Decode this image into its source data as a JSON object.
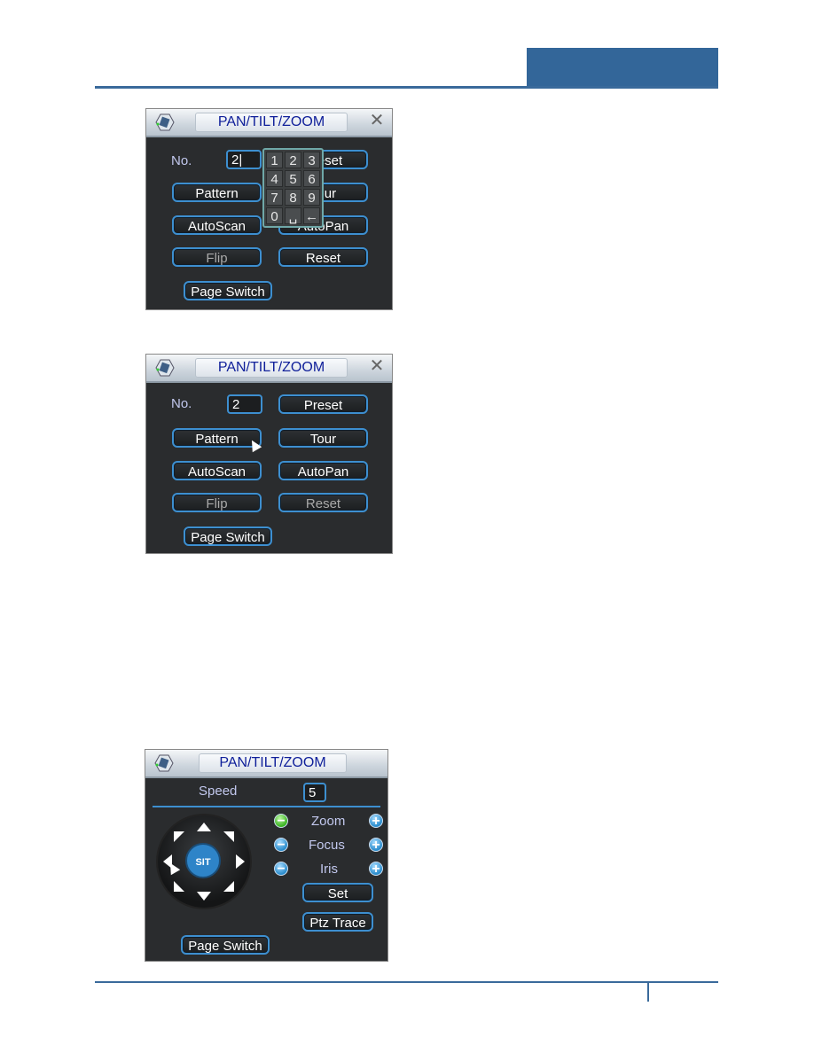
{
  "page": {
    "accent_color": "#336699"
  },
  "windows": [
    {
      "title": "PAN/TILT/ZOOM",
      "no_label": "No.",
      "no_value": "2|",
      "buttons": {
        "preset": "Preset",
        "pattern": "Pattern",
        "tour": "Tour",
        "autoscan": "AutoScan",
        "autopan": "AutoPan",
        "flip": "Flip",
        "reset": "Reset",
        "page_switch": "Page Switch"
      },
      "keypad": [
        "1",
        "2",
        "3",
        "4",
        "5",
        "6",
        "7",
        "8",
        "9",
        "0",
        "␣",
        "←"
      ]
    },
    {
      "title": "PAN/TILT/ZOOM",
      "no_label": "No.",
      "no_value": "2",
      "buttons": {
        "preset": "Preset",
        "pattern": "Pattern",
        "tour": "Tour",
        "autoscan": "AutoScan",
        "autopan": "AutoPan",
        "flip": "Flip",
        "reset": "Reset",
        "page_switch": "Page Switch"
      }
    },
    {
      "title": "PAN/TILT/ZOOM",
      "speed_label": "Speed",
      "speed_value": "5",
      "center_label": "SIT",
      "controls": [
        {
          "label": "Zoom",
          "minus": "−",
          "plus": "+"
        },
        {
          "label": "Focus",
          "minus": "−",
          "plus": "+"
        },
        {
          "label": "Iris",
          "minus": "−",
          "plus": "+"
        }
      ],
      "buttons": {
        "set": "Set",
        "ptz_trace": "Ptz Trace",
        "page_switch": "Page Switch"
      }
    }
  ]
}
